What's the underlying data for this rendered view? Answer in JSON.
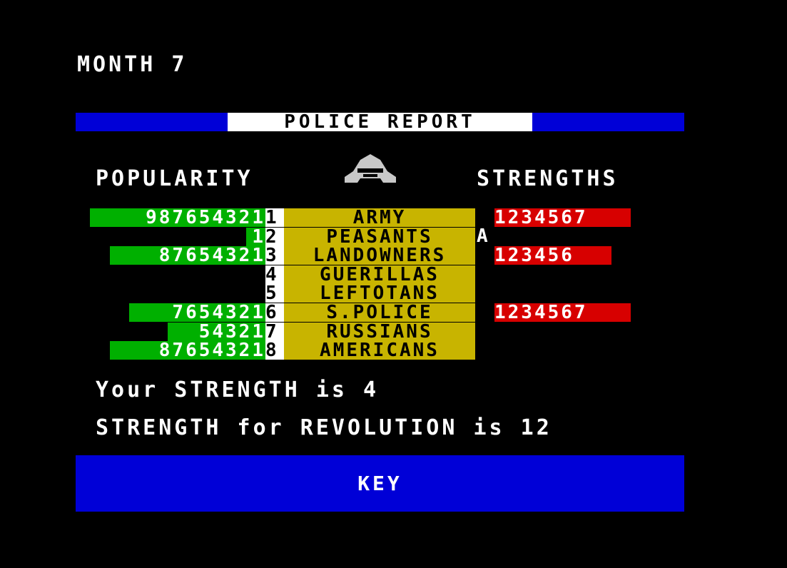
{
  "month": "MONTH 7",
  "banner_title": "POLICE  REPORT",
  "popularity_header": "POPULARITY",
  "strengths_header": "STRENGTHS",
  "groups": [
    {
      "num": "1",
      "name": "ARMY",
      "popularity": "987654321",
      "strength": "1234567"
    },
    {
      "num": "2",
      "name": "PEASANTS",
      "popularity": "1",
      "strength": ""
    },
    {
      "num": "3",
      "name": "LANDOWNERS",
      "popularity": "87654321",
      "strength": "123456"
    },
    {
      "num": "4",
      "name": "GUERILLAS",
      "popularity": "",
      "strength": ""
    },
    {
      "num": "5",
      "name": "LEFTOTANS",
      "popularity": "",
      "strength": ""
    },
    {
      "num": "6",
      "name": "S.POLICE",
      "popularity": "7654321",
      "strength": "1234567"
    },
    {
      "num": "7",
      "name": "RUSSIANS",
      "popularity": "54321",
      "strength": ""
    },
    {
      "num": "8",
      "name": "AMERICANS",
      "popularity": "87654321",
      "strength": ""
    }
  ],
  "player_marker": "A",
  "your_strength": "Your STRENGTH is 4",
  "revolution_strength": "STRENGTH for REVOLUTION is 12",
  "key_label": "KEY",
  "colors": {
    "blue": "#0000d7",
    "green": "#00b000",
    "yellow": "#c8b400",
    "red": "#d70000"
  },
  "icons": {
    "emblem": "police-helmet-icon"
  }
}
